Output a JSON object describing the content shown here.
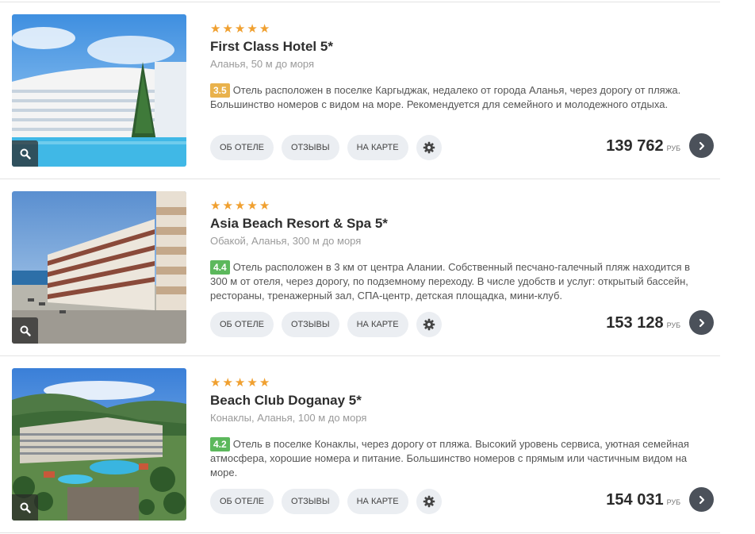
{
  "hotels": [
    {
      "stars": 5,
      "name": "First Class Hotel 5*",
      "location": "Аланья, 50 м до моря",
      "rating": "3.5",
      "rating_color": "#e9b24c",
      "description": "Отель расположен в поселке Каргыджак, недалеко от города Аланья, через дорогу от пляжа. Большинство номеров с видом на море. Рекомендуется для семейного и молодежного отдыха.",
      "buttons": {
        "about": "ОБ ОТЕЛЕ",
        "reviews": "ОТЗЫВЫ",
        "map": "НА КАРТЕ"
      },
      "price": "139 762",
      "currency": "РУБ"
    },
    {
      "stars": 5,
      "name": "Asia Beach Resort & Spa 5*",
      "location": "Обакой, Аланья, 300 м до моря",
      "rating": "4.4",
      "rating_color": "#5cb85c",
      "description": "Отель расположен в 3 км от центра Алании. Собственный песчано-галечный пляж находится в 300 м от отеля, через дорогу, по подземному переходу. В числе удобств и услуг: открытый бассейн, рестораны, тренажерный зал, СПА-центр, детская площадка, мини-клуб.",
      "buttons": {
        "about": "ОБ ОТЕЛЕ",
        "reviews": "ОТЗЫВЫ",
        "map": "НА КАРТЕ"
      },
      "price": "153 128",
      "currency": "РУБ"
    },
    {
      "stars": 5,
      "name": "Beach Club Doganay 5*",
      "location": "Конаклы, Аланья, 100 м до моря",
      "rating": "4.2",
      "rating_color": "#5cb85c",
      "description": "Отель в поселке Конаклы, через дорогу от пляжа. Высокий уровень сервиса, уютная семейная атмосфера, хорошие номера и питание. Большинство номеров с прямым или частичным видом на море.",
      "buttons": {
        "about": "ОБ ОТЕЛЕ",
        "reviews": "ОТЗЫВЫ",
        "map": "НА КАРТЕ"
      },
      "price": "154 031",
      "currency": "РУБ"
    }
  ],
  "icons": {
    "photo_zoom": "search-icon",
    "settings": "gear-icon",
    "go": "chevron-right-icon",
    "rating_star": "star-icon"
  }
}
